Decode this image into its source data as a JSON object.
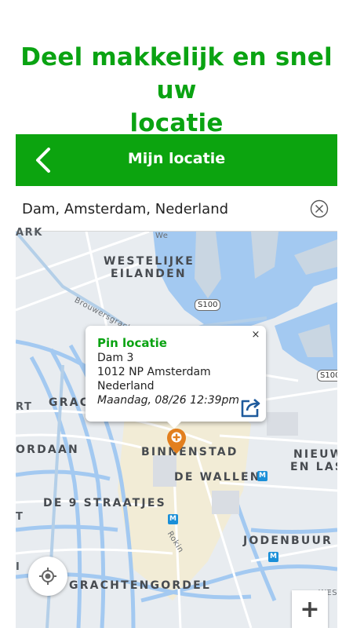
{
  "promo": {
    "line1": "Deel makkelijk en snel uw",
    "line2": "locatie"
  },
  "appbar": {
    "title": "Mijn locatie",
    "back_icon": "arrow-left-icon"
  },
  "search": {
    "value": "Dam, Amsterdam, Nederland",
    "clear_icon": "clear-circle-icon"
  },
  "map": {
    "labels": {
      "ark": "ARK",
      "westelijke": "WESTELIJKE",
      "eilanden": "EILANDEN",
      "brouwersgracht": "Brouwersgracht",
      "gracht": "GRACHT",
      "binnenstad": "BINNENSTAD",
      "jordaan": "ORDAAN",
      "de_wallen": "DE WALLEN",
      "de_9_straatjes": "DE 9 STRAATJES",
      "jodenbuurt": "JODENBUUR",
      "nieuwmarkt1": "NIEUWM",
      "nieuwmarkt2": "EN LAST",
      "grachtengordel": "GRACHTENGORDEL",
      "rokin": "Rokin",
      "we": "We",
      "rt": "RT",
      "t": "T",
      "i": "I",
      "west": "WEST"
    },
    "road_shields": [
      "S100",
      "S100"
    ]
  },
  "popup": {
    "title": "Pin locatie",
    "street": "Dam 3",
    "city": "1012 NP Amsterdam",
    "country": "Nederland",
    "timestamp": "Maandag, 08/26 12:39pm",
    "close_label": "×"
  },
  "controls": {
    "locate_icon": "crosshair-icon",
    "zoom_in_label": "+"
  },
  "colors": {
    "brand_green": "#0ca40f",
    "pin_orange": "#e27f1d",
    "water": "#a3c9f1"
  }
}
